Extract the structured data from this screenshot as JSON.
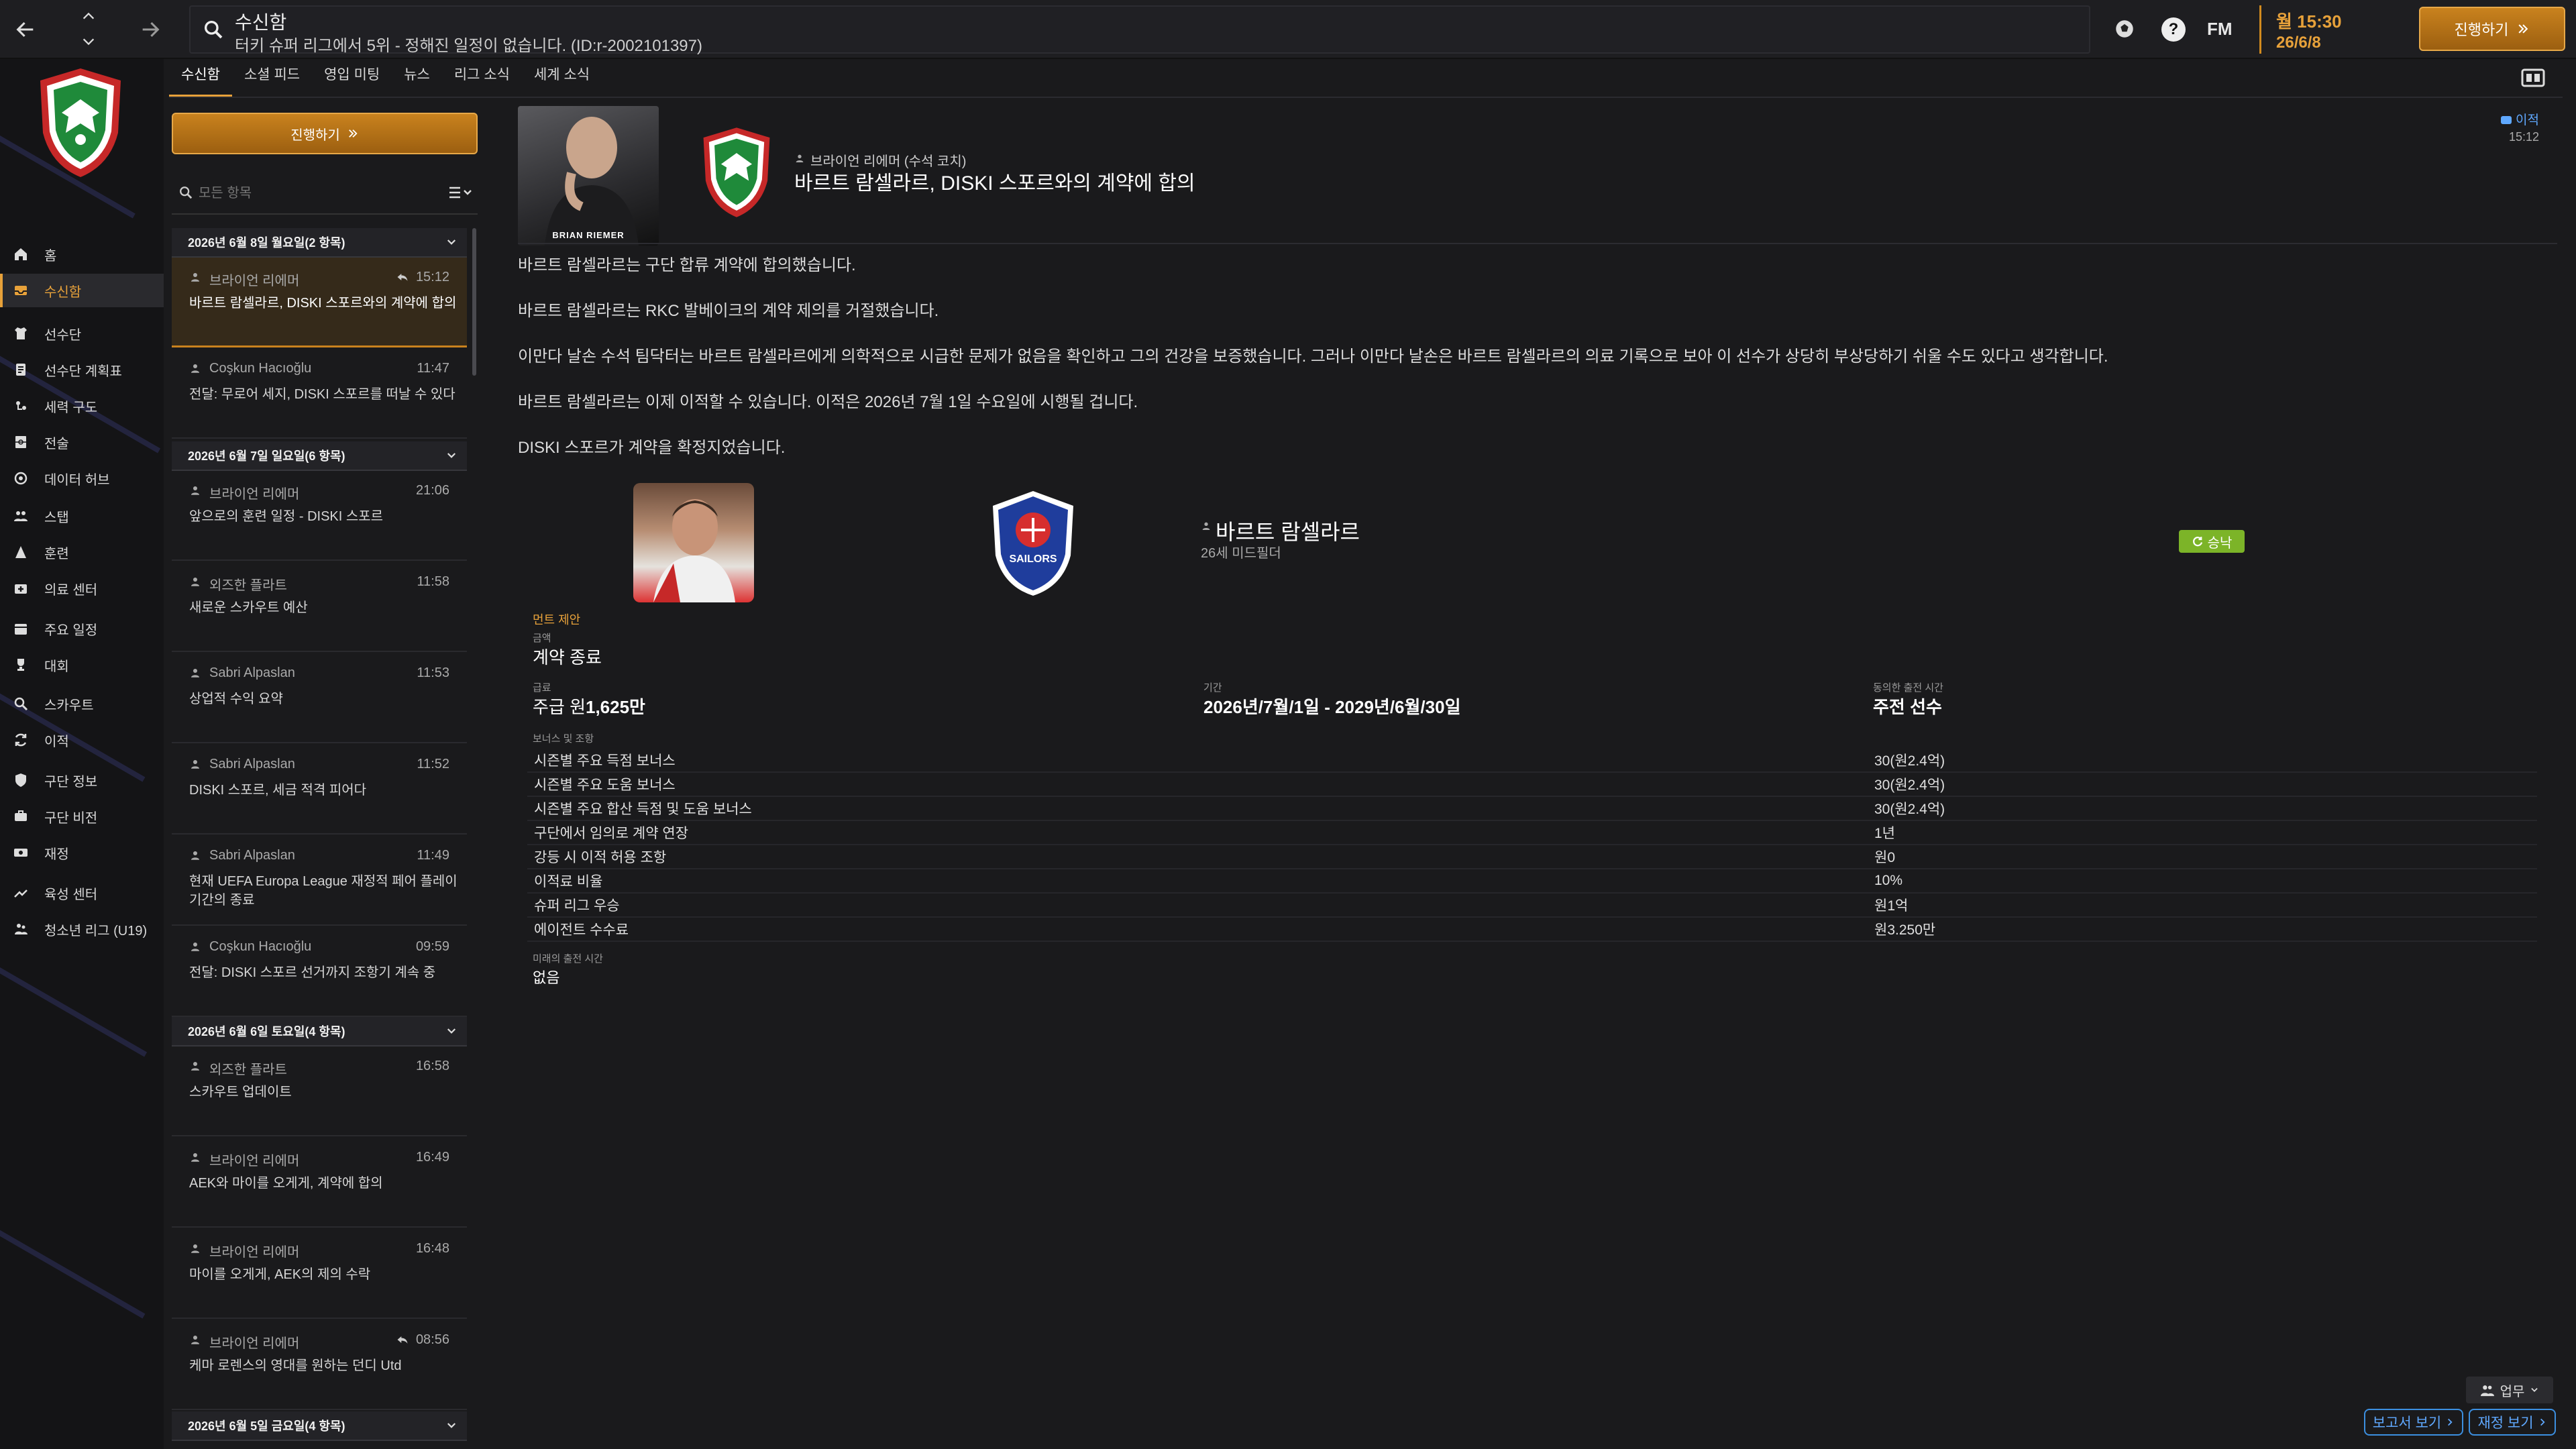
{
  "search": {
    "title": "수신함",
    "subtitle": "터키 슈퍼 리그에서 5위 - 정해진 일정이 없습니다. (ID:r-2002101397)"
  },
  "topbar": {
    "fm_label": "FM",
    "time": "월 15:30",
    "date": "26/6/8",
    "continue_label": "진행하기",
    "help_label": "?"
  },
  "sidebar": {
    "items": [
      {
        "label": "홈",
        "icon": "home-icon"
      },
      {
        "label": "수신함",
        "icon": "inbox-icon",
        "active": true
      },
      {
        "label": "선수단",
        "icon": "squad-icon"
      },
      {
        "label": "선수단 계획표",
        "icon": "planner-icon"
      },
      {
        "label": "세력 구도",
        "icon": "dynamics-icon"
      },
      {
        "label": "전술",
        "icon": "tactics-icon"
      },
      {
        "label": "데이터 허브",
        "icon": "data-hub-icon"
      },
      {
        "label": "스탭",
        "icon": "staff-icon"
      },
      {
        "label": "훈련",
        "icon": "training-icon"
      },
      {
        "label": "의료 센터",
        "icon": "medical-icon"
      },
      {
        "label": "주요 일정",
        "icon": "calendar-icon"
      },
      {
        "label": "대회",
        "icon": "trophy-icon"
      },
      {
        "label": "스카우트",
        "icon": "scouting-icon"
      },
      {
        "label": "이적",
        "icon": "transfers-icon"
      },
      {
        "label": "구단 정보",
        "icon": "club-info-icon"
      },
      {
        "label": "구단 비전",
        "icon": "club-vision-icon"
      },
      {
        "label": "재정",
        "icon": "finances-icon"
      },
      {
        "label": "육성 센터",
        "icon": "dev-centre-icon"
      },
      {
        "label": "청소년 리그 (U19)",
        "icon": "youth-icon"
      }
    ]
  },
  "subtabs": [
    "수신함",
    "소셜 피드",
    "영입 미팅",
    "뉴스",
    "리그 소식",
    "세계 소식"
  ],
  "inbox": {
    "continue_label": "진행하기",
    "filter_placeholder": "모든 항목",
    "groups": [
      {
        "header": "2026년 6월 8일 월요일(2 항목)",
        "messages": [
          {
            "from": "브라이언 리에머",
            "time": "15:12",
            "subject": "바르트 람셀라르, DISKI 스포르와의 계약에 합의",
            "selected": true,
            "replied": true
          },
          {
            "from": "Coşkun Hacıoğlu",
            "time": "11:47",
            "subject": "전달: 무로어 세지, DISKI 스포르를 떠날 수 있다"
          }
        ]
      },
      {
        "header": "2026년 6월 7일 일요일(6 항목)",
        "messages": [
          {
            "from": "브라이언 리에머",
            "time": "21:06",
            "subject": "앞으로의 훈련 일정 - DISKI 스포르"
          },
          {
            "from": "외즈한 플라트",
            "time": "11:58",
            "subject": "새로운 스카우트 예산"
          },
          {
            "from": "Sabri Alpaslan",
            "time": "11:53",
            "subject": "상업적 수익 요약"
          },
          {
            "from": "Sabri Alpaslan",
            "time": "11:52",
            "subject": "DISKI 스포르, 세금 적격 피어다"
          },
          {
            "from": "Sabri Alpaslan",
            "time": "11:49",
            "subject": "현재 UEFA Europa League 재정적 페어 플레이 기간의 종료"
          },
          {
            "from": "Coşkun Hacıoğlu",
            "time": "09:59",
            "subject": "전달: DISKI 스포르 선거까지 조항기 계속 중"
          }
        ]
      },
      {
        "header": "2026년 6월 6일 토요일(4 항목)",
        "messages": [
          {
            "from": "외즈한 플라트",
            "time": "16:58",
            "subject": "스카우트 업데이트"
          },
          {
            "from": "브라이언 리에머",
            "time": "16:49",
            "subject": "AEK와 마이를 오게게, 계약에 합의"
          },
          {
            "from": "브라이언 리에머",
            "time": "16:48",
            "subject": "마이를 오게게, AEK의 제의 수락"
          },
          {
            "from": "브라이언 리에머",
            "time": "08:56",
            "subject": "케마 로렌스의 영대를 원하는 던디 Utd",
            "replied": true
          }
        ]
      },
      {
        "header": "2026년 6월 5일 금요일(4 항목)",
        "messages": []
      }
    ]
  },
  "message": {
    "coach_caption": "BRIAN RIEMER",
    "sender": "브라이언 리에머 (수석 코치)",
    "subject": "바르트 람셀라르, DISKI 스포르와의 계약에 합의",
    "unread_badge": "이적",
    "time": "15:12",
    "paragraphs": [
      "바르트 람셀라르는 구단 합류 계약에 합의했습니다.",
      "바르트 람셀라르는 RKC 발베이크의 계약 제의를 거절했습니다.",
      "이만다 날손 수석 팀닥터는 바르트 람셀라르에게 의학적으로 시급한 문제가 없음을 확인하고 그의 건강을 보증했습니다. 그러나 이만다 날손은 바르트 람셀라르의 의료 기록으로 보아 이 선수가 상당히 부상당하기 쉬울 수도 있다고 생각합니다.",
      "바르트 람셀라르는 이제 이적할 수 있습니다. 이적은 2026년 7월 1일 수요일에 시행될 겁니다.",
      "DISKI 스포르가 계약을 확정지었습니다."
    ]
  },
  "contract": {
    "player_name": "바르트 람셀라르",
    "player_meta": "26세 미드필더",
    "club2_crest_text": "SAILORS",
    "status": "승낙",
    "offer_label": "먼트 제안",
    "type_label": "금액",
    "type_value": "계약 종료",
    "wage_label": "급료",
    "wage_prefix": "주급 원",
    "wage_value": "1,625만",
    "period_label": "기간",
    "period_value": "2026년/7월/1일 - 2029년/6월/30일",
    "role_label": "동의한 출전 시간",
    "role_value": "주전 선수",
    "bonus_label": "보너스 및 조항",
    "bonuses": [
      {
        "name": "시즌별 주요 득점 보너스",
        "value": "30(원2.4억)"
      },
      {
        "name": "시즌별 주요 도움 보너스",
        "value": "30(원2.4억)"
      },
      {
        "name": "시즌별 주요 합산 득점 및 도움 보너스",
        "value": "30(원2.4억)"
      },
      {
        "name": "구단에서 임의로 계약 연장",
        "value": "1년"
      },
      {
        "name": "강등 시 이적 허용 조항",
        "value": "원0"
      },
      {
        "name": "이적료 비율",
        "value": "10%"
      },
      {
        "name": "슈퍼 리그 우승",
        "value": "원1억"
      },
      {
        "name": "에이전트 수수료",
        "value": "원3.250만"
      }
    ],
    "min_label": "미래의 출전 시간",
    "min_value": "없음"
  },
  "footer": {
    "duty_label": "업무",
    "report_label": "보고서 보기",
    "finance_label": "재정 보기"
  },
  "colors": {
    "accent": "#e7a13a",
    "link": "#5fa8ff",
    "success": "#7cb428"
  }
}
